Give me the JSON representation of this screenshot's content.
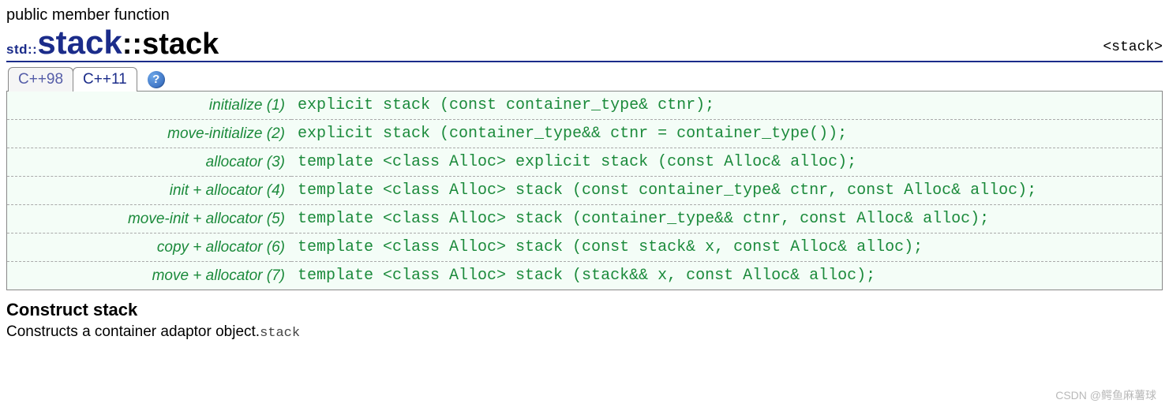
{
  "subtitle": "public member function",
  "namespace_prefix": "std::",
  "class_name": "stack",
  "member_sep": "::",
  "member_name": "stack",
  "header_include": "<stack>",
  "tabs": [
    "C++98",
    "C++11"
  ],
  "help_glyph": "?",
  "prototypes": [
    {
      "label": "initialize (1)",
      "code": "explicit stack (const container_type& ctnr);"
    },
    {
      "label": "move-initialize (2)",
      "code": "explicit stack (container_type&& ctnr = container_type());"
    },
    {
      "label": "allocator (3)",
      "code": "template <class Alloc> explicit stack (const Alloc& alloc);"
    },
    {
      "label": "init + allocator (4)",
      "code": "template <class Alloc> stack (const container_type& ctnr, const Alloc& alloc);"
    },
    {
      "label": "move-init + allocator (5)",
      "code": "template <class Alloc> stack (container_type&& ctnr, const Alloc& alloc);"
    },
    {
      "label": "copy + allocator (6)",
      "code": "template <class Alloc> stack (const stack& x, const Alloc& alloc);"
    },
    {
      "label": "move + allocator (7)",
      "code": "template <class Alloc> stack (stack&& x, const Alloc& alloc);"
    }
  ],
  "section_title": "Construct stack",
  "description_text": "Constructs a container adaptor object.",
  "description_mono": "stack",
  "watermark": "CSDN @鳄鱼麻薯球"
}
